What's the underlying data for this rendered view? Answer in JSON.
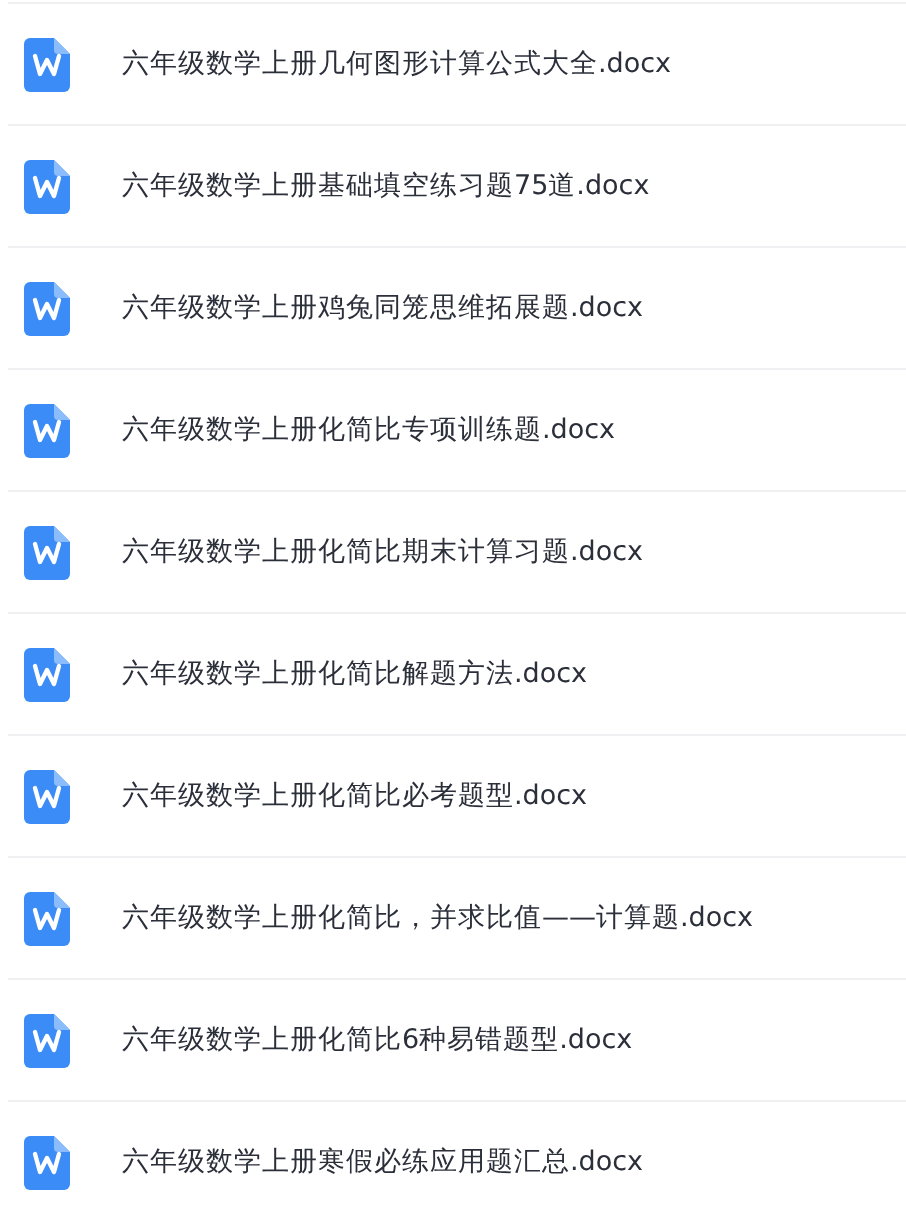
{
  "files": [
    {
      "name": "六年级数学上册几何图形计算公式大全.docx",
      "kind": "word"
    },
    {
      "name": "六年级数学上册基础填空练习题75道.docx",
      "kind": "word"
    },
    {
      "name": "六年级数学上册鸡兔同笼思维拓展题.docx",
      "kind": "word"
    },
    {
      "name": "六年级数学上册化简比专项训练题.docx",
      "kind": "word"
    },
    {
      "name": "六年级数学上册化简比期末计算习题.docx",
      "kind": "word"
    },
    {
      "name": "六年级数学上册化简比解题方法.docx",
      "kind": "word"
    },
    {
      "name": "六年级数学上册化简比必考题型.docx",
      "kind": "word"
    },
    {
      "name": "六年级数学上册化简比，并求比值——计算题.docx",
      "kind": "word"
    },
    {
      "name": "六年级数学上册化简比6种易错题型.docx",
      "kind": "word"
    },
    {
      "name": "六年级数学上册寒假必练应用题汇总.docx",
      "kind": "word"
    }
  ]
}
